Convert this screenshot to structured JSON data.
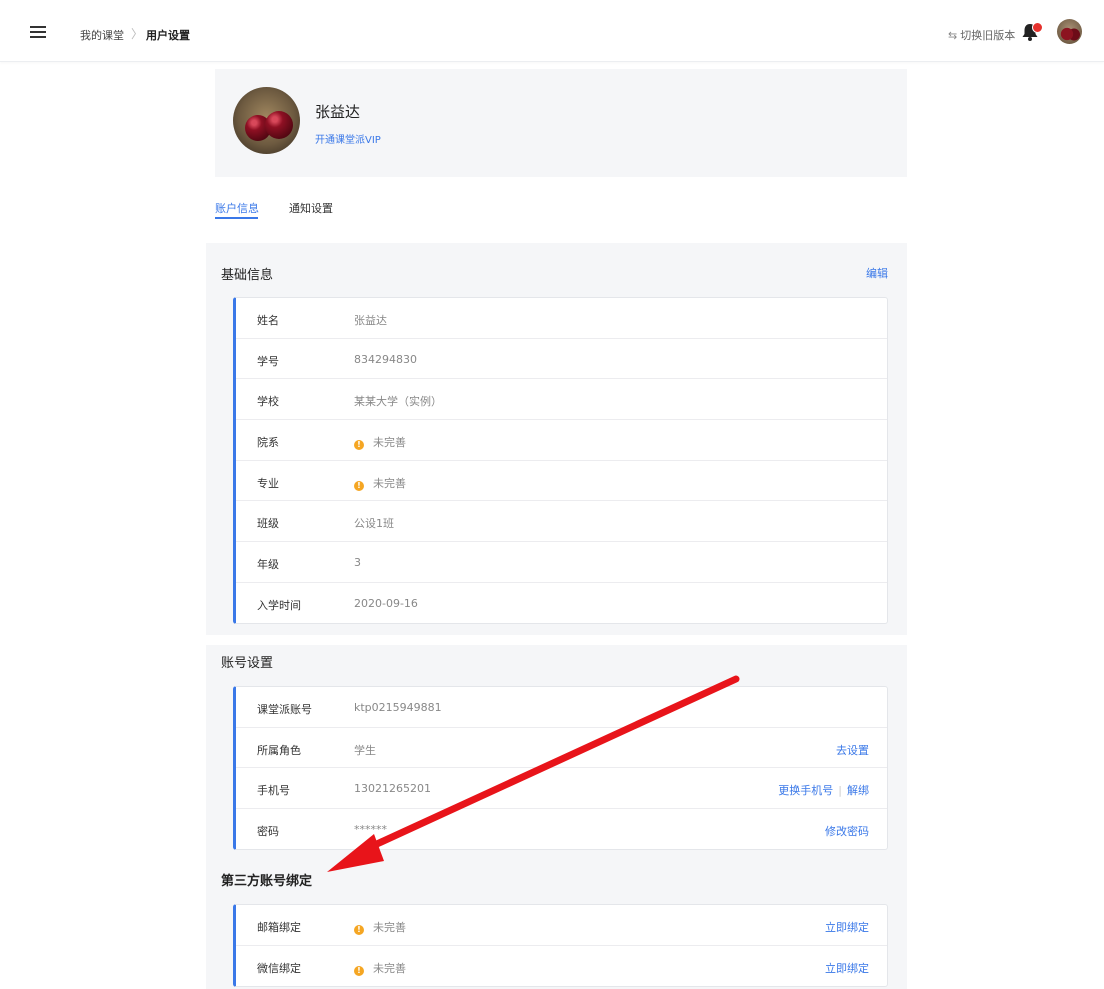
{
  "header": {
    "breadcrumb": [
      "我的课堂",
      "用户设置"
    ],
    "separator": "〉",
    "switch_label": "切换旧版本",
    "switch_icon": "⇆"
  },
  "profile": {
    "name": "张益达",
    "vip_link": "开通课堂派VIP"
  },
  "tabs": [
    {
      "label": "账户信息",
      "active": true
    },
    {
      "label": "通知设置",
      "active": false
    }
  ],
  "basic_info": {
    "title": "基础信息",
    "edit_label": "编辑",
    "rows": [
      {
        "label": "姓名",
        "value": "张益达",
        "warn": false
      },
      {
        "label": "学号",
        "value": "834294830",
        "warn": false
      },
      {
        "label": "学校",
        "value": "某某大学（实例）",
        "warn": false
      },
      {
        "label": "院系",
        "value": "未完善",
        "warn": true
      },
      {
        "label": "专业",
        "value": "未完善",
        "warn": true
      },
      {
        "label": "班级",
        "value": "公设1班",
        "warn": false
      },
      {
        "label": "年级",
        "value": "3",
        "warn": false
      },
      {
        "label": "入学时间",
        "value": "2020-09-16",
        "warn": false
      }
    ]
  },
  "account_settings": {
    "title": "账号设置",
    "rows": [
      {
        "label": "课堂派账号",
        "value": "ktp0215949881"
      },
      {
        "label": "所属角色",
        "value": "学生",
        "action": "去设置"
      },
      {
        "label": "手机号",
        "value": "13021265201",
        "actions": [
          "更换手机号",
          "解绑"
        ]
      },
      {
        "label": "密码",
        "value": "******",
        "action": "修改密码"
      }
    ]
  },
  "third_party": {
    "title": "第三方账号绑定",
    "rows": [
      {
        "label": "邮箱绑定",
        "value": "未完善",
        "action": "立即绑定"
      },
      {
        "label": "微信绑定",
        "value": "未完善",
        "action": "立即绑定"
      }
    ]
  },
  "colors": {
    "accent": "#3a78e8",
    "warning": "#f5a623",
    "annotation_arrow": "#e8141a",
    "badge": "#e5312d"
  },
  "icons": {
    "menu": "hamburger-icon",
    "switch": "swap-arrows-icon",
    "bell": "bell-icon",
    "warn": "warning-dot-icon"
  }
}
